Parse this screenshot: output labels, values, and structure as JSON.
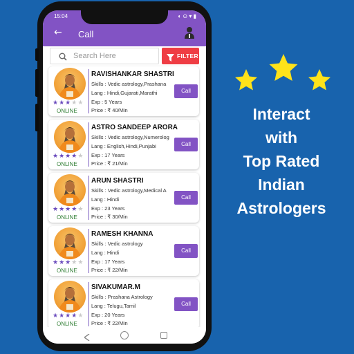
{
  "status_bar": {
    "time": "15:04",
    "right": "◐ ⊙ ▾ ▮"
  },
  "app_bar": {
    "back_icon": "arrow-left-icon",
    "title": "Call",
    "user_icon": "user-icon"
  },
  "search": {
    "placeholder": "Search Here",
    "filter_label": "FILTER"
  },
  "astrologers": [
    {
      "name": "RAVISHANKAR SHASTRI",
      "skills": "Skills : Vedic astrology,Prashana",
      "lang": "Lang : Hindi,Gujarati,Marathi",
      "exp": "Exp : 5 Years",
      "price": "Price : ₹ 40/Min",
      "rating": 3,
      "status": "ONLINE",
      "call_label": "Call"
    },
    {
      "name": "ASTRO SANDEEP ARORA",
      "skills": "Skills : Vedic astrology,Numerolog",
      "lang": "Lang : English,Hindi,Punjabi",
      "exp": "Exp : 17 Years",
      "price": "Price : ₹ 21/Min",
      "rating": 4,
      "status": "ONLINE",
      "call_label": "Call"
    },
    {
      "name": "ARUN SHASTRI",
      "skills": "Skills : Vedic astrology,Medical A",
      "lang": "Lang : Hindi",
      "exp": "Exp : 23 Years",
      "price": "Price : ₹ 30/Min",
      "rating": 4,
      "status": "ONLINE",
      "call_label": "Call"
    },
    {
      "name": "RAMESH KHANNA",
      "skills": "Skills : Vedic astrology",
      "lang": "Lang : Hindi",
      "exp": "Exp : 17 Years",
      "price": "Price : ₹ 22/Min",
      "rating": 3,
      "status": "ONLINE",
      "call_label": "Call"
    },
    {
      "name": "SIVAKUMAR.M",
      "skills": "Skills : Prashana Astrology",
      "lang": "Lang : Telugu,Tamil",
      "exp": "Exp : 20 Years",
      "price": "Price : ₹ 22/Min",
      "rating": 4,
      "status": "ONLINE",
      "call_label": "Call"
    }
  ],
  "promo": {
    "lines": [
      "Interact",
      "with",
      "Top Rated",
      "Indian",
      "Astrologers"
    ]
  },
  "colors": {
    "background": "#1863ad",
    "primary": "#8253c4",
    "filter": "#ef3d44",
    "star": "#ffe21a",
    "online": "#2e7d32"
  }
}
